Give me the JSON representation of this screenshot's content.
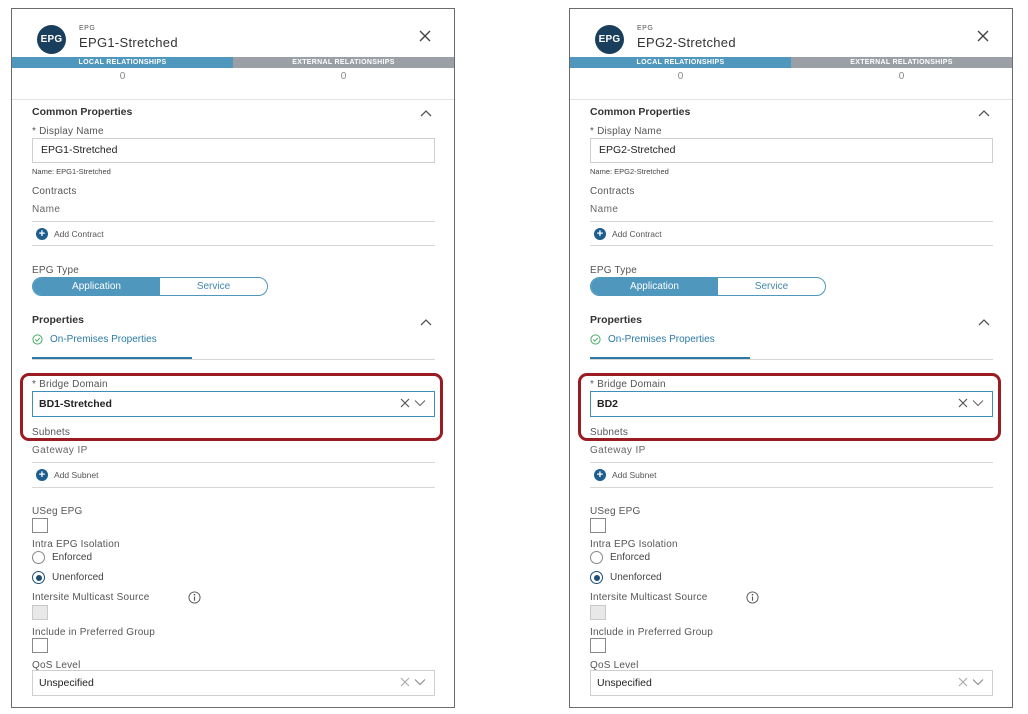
{
  "panels": [
    {
      "header": {
        "badge": "EPG",
        "type": "EPG",
        "title": "EPG1-Stretched"
      },
      "tabs": {
        "local": "LOCAL RELATIONSHIPS",
        "external": "EXTERNAL RELATIONSHIPS",
        "local_count": "0",
        "external_count": "0"
      },
      "common": {
        "title": "Common Properties",
        "display_name_label": "* Display Name",
        "display_name_value": "EPG1-Stretched",
        "name_note": "Name: EPG1-Stretched",
        "contracts_label": "Contracts",
        "contracts_col": "Name",
        "add_contract": "Add Contract",
        "epg_type_label": "EPG Type",
        "epg_type_options": [
          "Application",
          "Service"
        ]
      },
      "properties": {
        "title": "Properties",
        "subtab": "On-Premises Properties",
        "bd_label": "* Bridge Domain",
        "bd_value": "BD1-Stretched",
        "subnets_label": "Subnets",
        "gateway_col": "Gateway IP",
        "add_subnet": "Add Subnet",
        "useg_label": "USeg EPG",
        "isolation_label": "Intra EPG Isolation",
        "enforced": "Enforced",
        "unenforced": "Unenforced",
        "multicast_label": "Intersite Multicast Source",
        "preferred_label": "Include in Preferred Group",
        "qos_label": "QoS Level",
        "qos_value": "Unspecified"
      }
    },
    {
      "header": {
        "badge": "EPG",
        "type": "EPG",
        "title": "EPG2-Stretched"
      },
      "tabs": {
        "local": "LOCAL RELATIONSHIPS",
        "external": "EXTERNAL RELATIONSHIPS",
        "local_count": "0",
        "external_count": "0"
      },
      "common": {
        "title": "Common Properties",
        "display_name_label": "* Display Name",
        "display_name_value": "EPG2-Stretched",
        "name_note": "Name: EPG2-Stretched",
        "contracts_label": "Contracts",
        "contracts_col": "Name",
        "add_contract": "Add Contract",
        "epg_type_label": "EPG Type",
        "epg_type_options": [
          "Application",
          "Service"
        ]
      },
      "properties": {
        "title": "Properties",
        "subtab": "On-Premises Properties",
        "bd_label": "* Bridge Domain",
        "bd_value": "BD2",
        "subnets_label": "Subnets",
        "gateway_col": "Gateway IP",
        "add_subnet": "Add Subnet",
        "useg_label": "USeg EPG",
        "isolation_label": "Intra EPG Isolation",
        "enforced": "Enforced",
        "unenforced": "Unenforced",
        "multicast_label": "Intersite Multicast Source",
        "preferred_label": "Include in Preferred Group",
        "qos_label": "QoS Level",
        "qos_value": "Unspecified"
      }
    }
  ],
  "colors": {
    "accent": "#4f97bd",
    "highlight": "#9b1b22",
    "badge": "#1a3f5c"
  },
  "icons": [
    "close-icon",
    "caret-up-icon",
    "plus-icon",
    "check-circle-icon",
    "clear-icon",
    "chevron-down-icon",
    "info-icon"
  ]
}
